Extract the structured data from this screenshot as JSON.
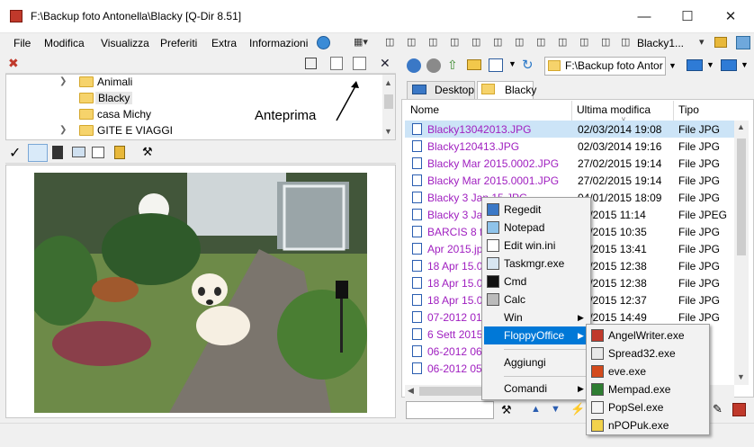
{
  "window": {
    "title": "F:\\Backup foto Antonella\\Blacky  [Q-Dir 8.51]"
  },
  "menu": {
    "items": [
      "File",
      "Modifica",
      "Visualizza",
      "Preferiti",
      "Extra",
      "Informazioni"
    ],
    "user_label": "Blacky1..."
  },
  "left_pane": {
    "tree": [
      {
        "label": "Animali",
        "expandable": true
      },
      {
        "label": "Blacky",
        "expandable": false,
        "selected": true
      },
      {
        "label": "casa Michy",
        "expandable": false
      },
      {
        "label": "GITE E VIAGGI",
        "expandable": true
      }
    ],
    "annotation": "Anteprima"
  },
  "right_pane": {
    "path": "F:\\Backup foto Antor",
    "tabs": [
      "Desktop",
      "Blacky"
    ],
    "columns": [
      "Nome",
      "Ultima modifica",
      "Tipo"
    ],
    "files": [
      {
        "name": "Blacky13042013.JPG",
        "date": "02/03/2014 19:08",
        "type": "File JPG",
        "selected": true
      },
      {
        "name": "Blacky120413.JPG",
        "date": "02/03/2014 19:16",
        "type": "File JPG"
      },
      {
        "name": "Blacky Mar 2015.0002.JPG",
        "date": "27/02/2015 19:14",
        "type": "File JPG"
      },
      {
        "name": "Blacky Mar 2015.0001.JPG",
        "date": "27/02/2015 19:14",
        "type": "File JPG"
      },
      {
        "name": "Blacky 3 Jan 15.JPG",
        "date": "04/01/2015 18:09",
        "type": "File JPG"
      },
      {
        "name": "Blacky 3 Jan",
        "date": "02/2015 11:14",
        "type": "File JPEG"
      },
      {
        "name": "BARCIS 8 fe",
        "date": "02/2015 10:35",
        "type": "File JPG"
      },
      {
        "name": "Apr 2015.jp",
        "date": "04/2015 13:41",
        "type": "File JPG"
      },
      {
        "name": "18 Apr 15.0",
        "date": "04/2015 12:38",
        "type": "File JPG"
      },
      {
        "name": "18 Apr 15.0",
        "date": "04/2015 12:38",
        "type": "File JPG"
      },
      {
        "name": "18 Apr 15.0",
        "date": "04/2015 12:37",
        "type": "File JPG"
      },
      {
        "name": "07-2012 01",
        "date": "04/2015 14:49",
        "type": "File JPG"
      },
      {
        "name": "6 Sett 2015.",
        "date": "",
        "type": ""
      },
      {
        "name": "06-2012 06",
        "date": "",
        "type": ""
      },
      {
        "name": "06-2012 05.",
        "date": "",
        "type": ""
      }
    ]
  },
  "context_menu": {
    "items": [
      {
        "label": "Regedit",
        "icon": "regedit-icon"
      },
      {
        "label": "Notepad",
        "icon": "notepad-icon"
      },
      {
        "label": "Edit win.ini",
        "icon": "edit-icon"
      },
      {
        "label": "Taskmgr.exe",
        "icon": "taskmgr-icon"
      },
      {
        "label": "Cmd",
        "icon": "cmd-icon"
      },
      {
        "label": "Calc",
        "icon": "calc-icon"
      },
      {
        "label": "Win",
        "submenu": true
      },
      {
        "label": "FloppyOffice",
        "submenu": true,
        "highlighted": true
      },
      {
        "label": "Aggiungi"
      },
      {
        "label": "Comandi",
        "submenu": true
      }
    ]
  },
  "submenu": {
    "items": [
      "AngelWriter.exe",
      "Spread32.exe",
      "eve.exe",
      "Mempad.exe",
      "PopSel.exe",
      "nPOPuk.exe"
    ]
  },
  "colors": {
    "file_name": "#a020c0",
    "selection": "#cce4f7",
    "menu_highlight": "#0078d7",
    "folder": "#f6d36b"
  }
}
